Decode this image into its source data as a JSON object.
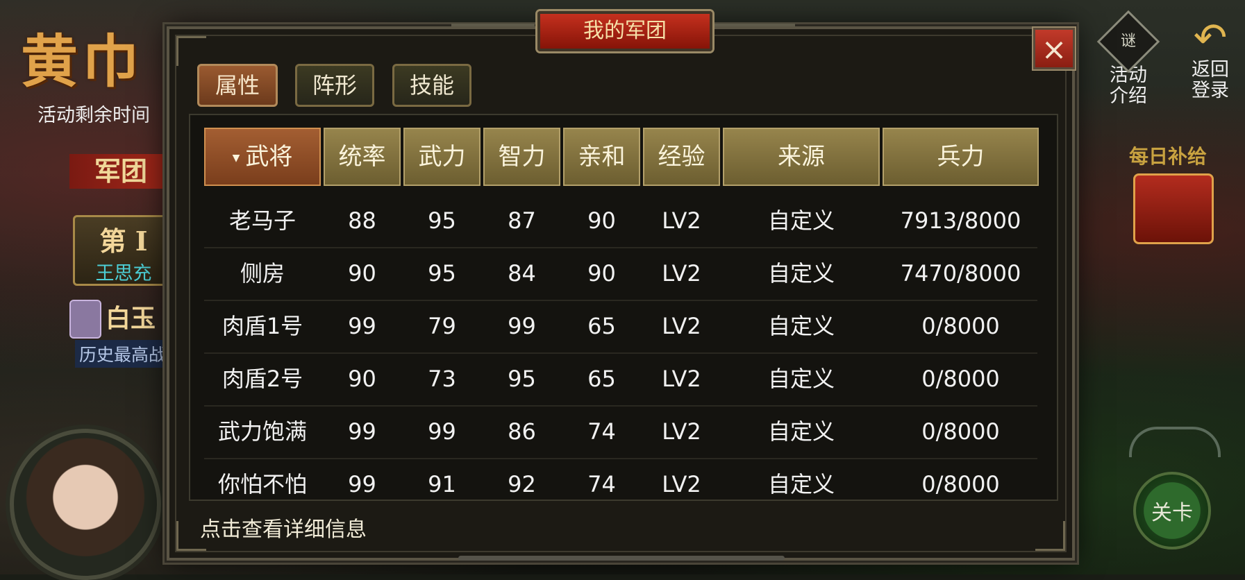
{
  "background": {
    "event_title": "黄巾",
    "remaining_time_label": "活动剩余时间",
    "legion_banner": "军团",
    "stage_card": {
      "title": "第 I",
      "name": "王思充"
    },
    "jade_card": {
      "title": "白玉",
      "subtitle": "历史最高战"
    },
    "right": {
      "activity_intro": "活动\n介绍",
      "activity_icon": "谜",
      "return_login": "返回\n登录",
      "daily_supply": "每日补给",
      "stage_button": "关卡"
    }
  },
  "dialog": {
    "title": "我的军团",
    "close_label": "×",
    "tabs": [
      {
        "label": "属性",
        "active": true
      },
      {
        "label": "阵形",
        "active": false
      },
      {
        "label": "技能",
        "active": false
      }
    ],
    "columns": [
      "武将",
      "统率",
      "武力",
      "智力",
      "亲和",
      "经验",
      "来源",
      "兵力"
    ],
    "rows": [
      [
        "老马子",
        "88",
        "95",
        "87",
        "90",
        "LV2",
        "自定义",
        "7913/8000"
      ],
      [
        "侧房",
        "90",
        "95",
        "84",
        "90",
        "LV2",
        "自定义",
        "7470/8000"
      ],
      [
        "肉盾1号",
        "99",
        "79",
        "99",
        "65",
        "LV2",
        "自定义",
        "0/8000"
      ],
      [
        "肉盾2号",
        "90",
        "73",
        "95",
        "65",
        "LV2",
        "自定义",
        "0/8000"
      ],
      [
        "武力饱满",
        "99",
        "99",
        "86",
        "74",
        "LV2",
        "自定义",
        "0/8000"
      ],
      [
        "你怕不怕",
        "99",
        "91",
        "92",
        "74",
        "LV2",
        "自定义",
        "0/8000"
      ]
    ],
    "footer_hint": "点击查看详细信息"
  }
}
